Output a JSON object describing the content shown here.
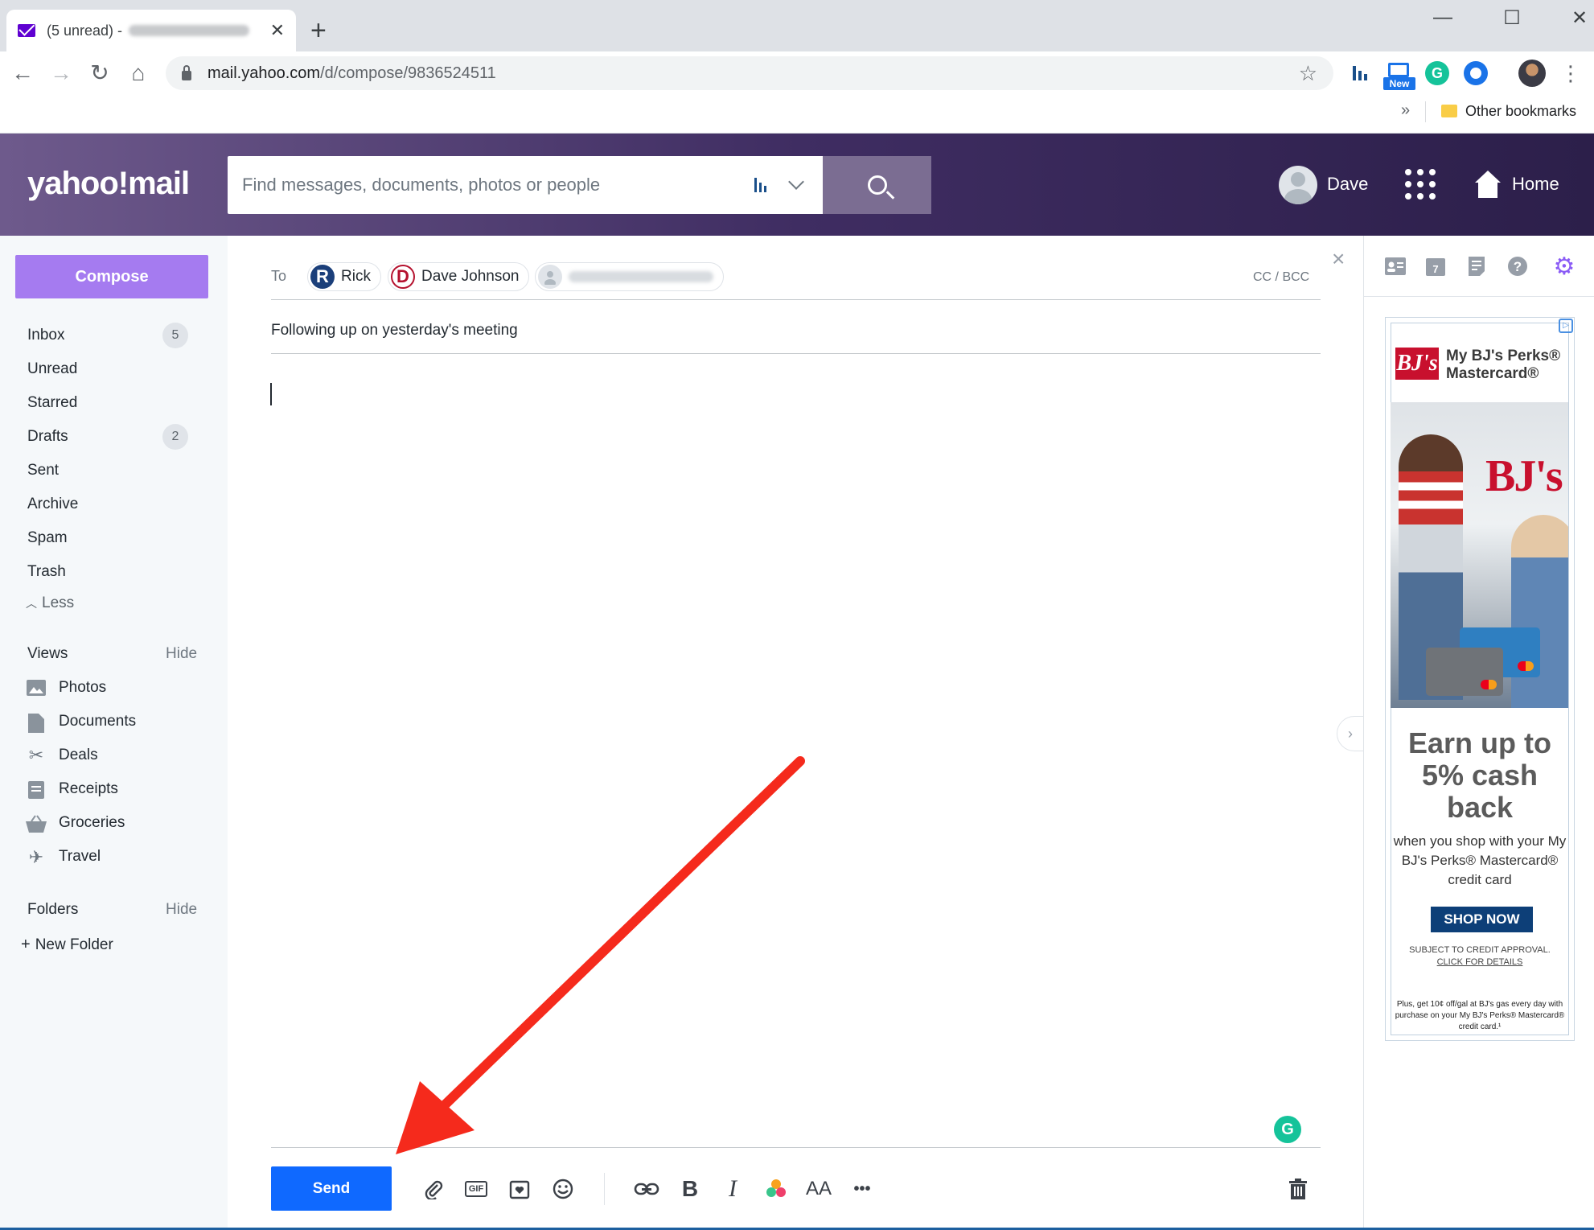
{
  "browser": {
    "tab_title": "(5 unread) -",
    "tab_close": "✕",
    "new_tab": "+",
    "url_host": "mail.yahoo.com",
    "url_path": "/d/compose/9836524511",
    "ext_new_badge": "New",
    "ext_grammarly": "G",
    "bookmarks_overflow": "»",
    "other_bookmarks": "Other bookmarks",
    "win_minimize": "—",
    "win_maximize": "☐",
    "win_close": "✕"
  },
  "header": {
    "logo": "yahoo!mail",
    "search_placeholder": "Find messages, documents, photos or people",
    "user_name": "Dave",
    "home_label": "Home"
  },
  "sidebar": {
    "compose_label": "Compose",
    "folders": [
      {
        "label": "Inbox",
        "count": "5"
      },
      {
        "label": "Unread",
        "count": ""
      },
      {
        "label": "Starred",
        "count": ""
      },
      {
        "label": "Drafts",
        "count": "2"
      },
      {
        "label": "Sent",
        "count": ""
      },
      {
        "label": "Archive",
        "count": ""
      },
      {
        "label": "Spam",
        "count": ""
      },
      {
        "label": "Trash",
        "count": ""
      }
    ],
    "less_label": "Less",
    "views_header": "Views",
    "views_hide": "Hide",
    "views": [
      {
        "label": "Photos",
        "icon": "photo-icon"
      },
      {
        "label": "Documents",
        "icon": "document-icon"
      },
      {
        "label": "Deals",
        "icon": "scissors-icon"
      },
      {
        "label": "Receipts",
        "icon": "receipt-icon"
      },
      {
        "label": "Groceries",
        "icon": "basket-icon"
      },
      {
        "label": "Travel",
        "icon": "plane-icon"
      }
    ],
    "folders_header": "Folders",
    "folders_hide": "Hide",
    "new_folder": "New Folder"
  },
  "compose": {
    "to_label": "To",
    "recipients": [
      {
        "initial": "R",
        "name": "Rick",
        "color": "#1b3f7a"
      },
      {
        "initial": "D",
        "name": "Dave Johnson",
        "color": "#b5122f"
      }
    ],
    "cc_bcc": "CC / BCC",
    "subject": "Following up on yesterday's meeting",
    "body": "",
    "send_label": "Send",
    "gif_label": "GIF",
    "bold_label": "B",
    "italic_label": "I",
    "font_size_label": "AA",
    "more_label": "•••"
  },
  "ad": {
    "logo": "BJ's",
    "brand_line1": "My BJ's Perks®",
    "brand_line2": "Mastercard®",
    "store_sign": "BJ's",
    "headline": "Earn up to 5% cash back",
    "subline": "when you shop with your My BJ's Perks® Mastercard® credit card",
    "cta": "SHOP NOW",
    "credit_line": "SUBJECT TO CREDIT APPROVAL.",
    "details_link": "CLICK FOR DETAILS",
    "fine_print": "Plus, get 10¢ off/gal at BJ's gas every day with purchase on your My BJ's Perks® Mastercard® credit card.¹"
  },
  "colors": {
    "header_gradient_start": "#6e5a8c",
    "header_gradient_end": "#2c1f4a",
    "compose_button": "#a57bf0",
    "send_button": "#0f69ff",
    "annotation_arrow": "#f52a1c"
  }
}
